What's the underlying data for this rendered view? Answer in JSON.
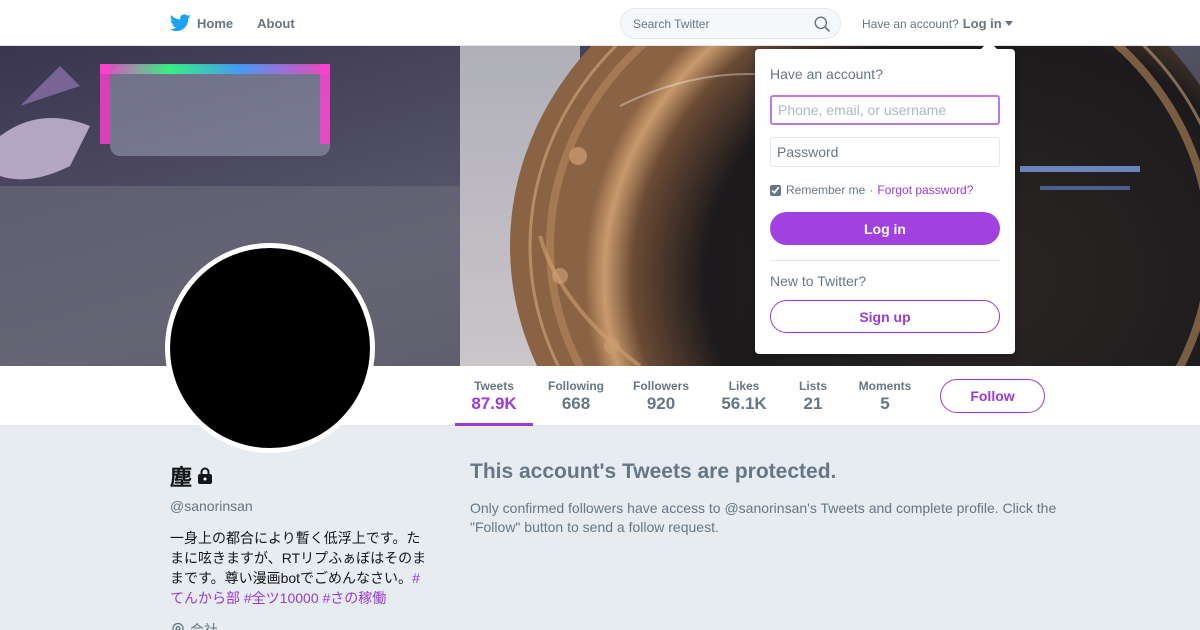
{
  "nav": {
    "home_label": "Home",
    "about_label": "About",
    "search_placeholder": "Search Twitter",
    "have_account": "Have an account?",
    "login_label": "Log in"
  },
  "profile": {
    "display_name": "塵",
    "screen_name": "@sanorinsan",
    "bio_text": "一身上の都合により暫く低浮上です。たまに呟きますが、RTリプふぁぼはそのままです。尊い漫画botでごめんなさい。",
    "bio_tags": [
      "#てんから部",
      "#全ツ10000",
      "#さの稼働"
    ],
    "location": "会社"
  },
  "stats": [
    {
      "label": "Tweets",
      "value": "87.9K",
      "active": true
    },
    {
      "label": "Following",
      "value": "668",
      "active": false
    },
    {
      "label": "Followers",
      "value": "920",
      "active": false
    },
    {
      "label": "Likes",
      "value": "56.1K",
      "active": false
    },
    {
      "label": "Lists",
      "value": "21",
      "active": false
    },
    {
      "label": "Moments",
      "value": "5",
      "active": false
    }
  ],
  "follow_label": "Follow",
  "protected": {
    "heading": "This account's Tweets are protected.",
    "message": "Only confirmed followers have access to @sanorinsan's Tweets and complete profile. Click the \"Follow\" button to send a follow request."
  },
  "login_dropdown": {
    "title": "Have an account?",
    "username_placeholder": "Phone, email, or username",
    "password_placeholder": "Password",
    "remember_label": "Remember me",
    "separator": "·",
    "forgot_label": "Forgot password?",
    "login_button": "Log in",
    "new_prompt": "New to Twitter?",
    "signup_button": "Sign up"
  },
  "colors": {
    "accent": "#9b3ad8",
    "accent_button": "#a142e0",
    "twitter_blue": "#1da1f2",
    "muted_text": "#657786",
    "page_background": "#e6ecf0"
  },
  "icons": [
    "twitter-bird-icon",
    "search-icon",
    "caret-down-icon",
    "lock-icon",
    "location-pin-icon"
  ]
}
